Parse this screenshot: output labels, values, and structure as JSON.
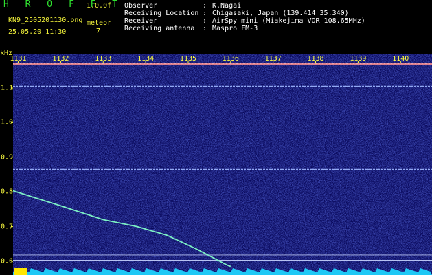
{
  "app": {
    "title": "H R O F F T",
    "version": "1.0.0f",
    "filename": "KN9_2505201130.png",
    "mode_label": "meteor",
    "mode_value": "7",
    "datetime": "25.05.20 11:30"
  },
  "info": [
    {
      "key": "Observer",
      "value": "K.Nagai"
    },
    {
      "key": "Receiving Location",
      "value": "Chigasaki, Japan (139.414 35.340)"
    },
    {
      "key": "Receiver",
      "value": "AirSpy mini (Miakejima VOR 108.65MHz)"
    },
    {
      "key": "Receiving antenna",
      "value": "Maspro FM-3"
    }
  ],
  "chart_data": {
    "type": "heatmap",
    "ylabel": "kHz",
    "x_ticks": [
      "1131",
      "1132",
      "1133",
      "1134",
      "1135",
      "1136",
      "1137",
      "1138",
      "1139",
      "1140"
    ],
    "y_ticks": [
      "1.1",
      "1.0",
      "0.9",
      "0.8",
      "0.7",
      "0.6"
    ],
    "ylim": [
      0.58,
      1.17
    ],
    "horizontal_lines_khz": [
      1.105,
      0.865,
      0.618,
      0.603
    ],
    "meteor_trace": {
      "x": [
        1130.7,
        1132.0,
        1133.0,
        1133.8,
        1134.5,
        1135.2,
        1135.9,
        1136.0
      ],
      "y": [
        0.81,
        0.76,
        0.72,
        0.7,
        0.675,
        0.635,
        0.59,
        0.585
      ]
    },
    "xlim": [
      1130.7,
      1140.4
    ],
    "colors": {
      "background": "#0a0a5e",
      "noise": "#2a34b8",
      "line": "#9fb7ff",
      "trace": "#7cf0c4",
      "top_band": "#ff8f8f",
      "bottom_band": "#1ec8f5",
      "label": "#ffff40"
    }
  }
}
